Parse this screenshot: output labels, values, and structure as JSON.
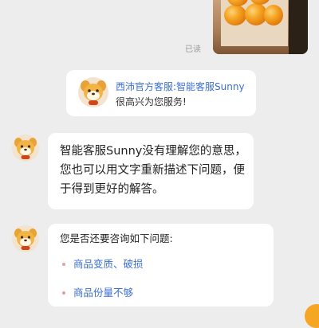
{
  "status": {
    "read_label": "已读"
  },
  "agent_card": {
    "title": "西沛官方客服:智能客服Sunny",
    "subtitle": "很高兴为您服务!"
  },
  "messages": [
    {
      "text": "智能客服Sunny没有理解您的意思，您也可以用文字重新描述下问题，便于得到更好的解答。"
    },
    {
      "prompt": "您是否还要咨询如下问题:",
      "options": [
        "商品变质、破损",
        "商品份量不够"
      ]
    }
  ],
  "colors": {
    "accent": "#3b6fd4",
    "background": "#ededed",
    "bubble": "#ffffff"
  }
}
